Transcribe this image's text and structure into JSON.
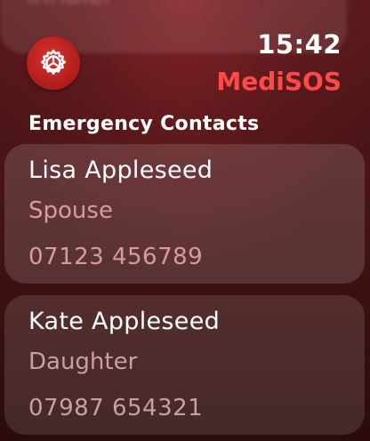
{
  "header": {
    "previous_item": "Inhaler",
    "time": "15:42",
    "app_name": "MediSOS",
    "settings_icon": "gear-icon"
  },
  "section": {
    "title": "Emergency Contacts"
  },
  "contacts": [
    {
      "name": "Lisa Appleseed",
      "relation": "Spouse",
      "phone": "07123 456789"
    },
    {
      "name": "Kate Appleseed",
      "relation": "Daughter",
      "phone": "07987 654321"
    }
  ],
  "colors": {
    "accent": "#ff4a4a",
    "settings_button": "#c0221f",
    "secondary_text": "#d79aa0"
  }
}
